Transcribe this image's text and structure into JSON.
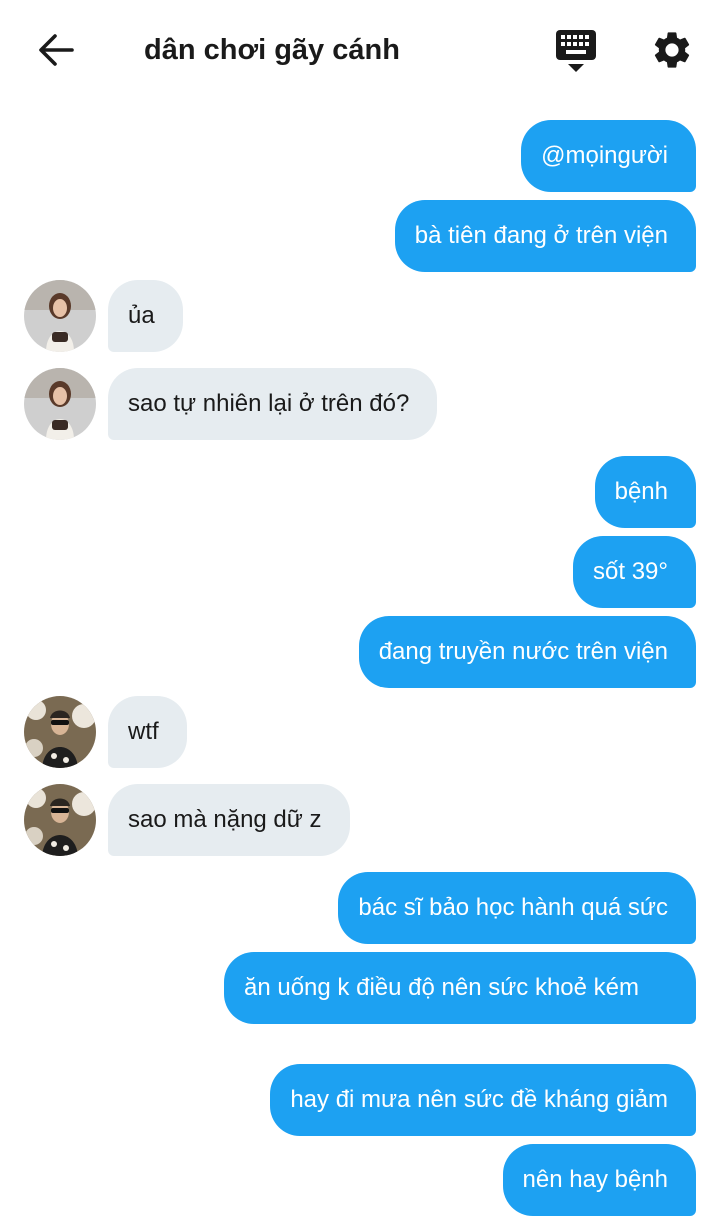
{
  "header": {
    "title": "dân chơi gãy cánh",
    "back_icon": "arrow-left-icon",
    "keyboard_icon": "keyboard-icon",
    "settings_icon": "gear-icon"
  },
  "colors": {
    "outgoing_bubble": "#1da1f2",
    "incoming_bubble": "#e6ecf0",
    "outgoing_text": "#ffffff",
    "incoming_text": "#1a1a1a"
  },
  "messages": [
    {
      "direction": "out",
      "text": "@mọingười"
    },
    {
      "direction": "out",
      "text": "bà tiên đang ở trên viện"
    },
    {
      "direction": "in",
      "sender": "avatar-1",
      "text": "ủa"
    },
    {
      "direction": "in",
      "sender": "avatar-1",
      "text": "sao tự nhiên lại ở trên đó?"
    },
    {
      "direction": "out",
      "text": "bệnh"
    },
    {
      "direction": "out",
      "text": "sốt 39°"
    },
    {
      "direction": "out",
      "text": "đang truyền nước trên viện"
    },
    {
      "direction": "in",
      "sender": "avatar-2",
      "text": "wtf"
    },
    {
      "direction": "in",
      "sender": "avatar-2",
      "text": "sao mà nặng dữ z"
    },
    {
      "direction": "out",
      "text": "bác sĩ bảo học hành quá sức"
    },
    {
      "direction": "out",
      "text": "ăn uống k điều độ nên sức khoẻ kém"
    },
    {
      "direction": "out",
      "text": "hay đi mưa nên sức đề kháng giảm"
    },
    {
      "direction": "out",
      "text": "nên hay bệnh"
    }
  ]
}
